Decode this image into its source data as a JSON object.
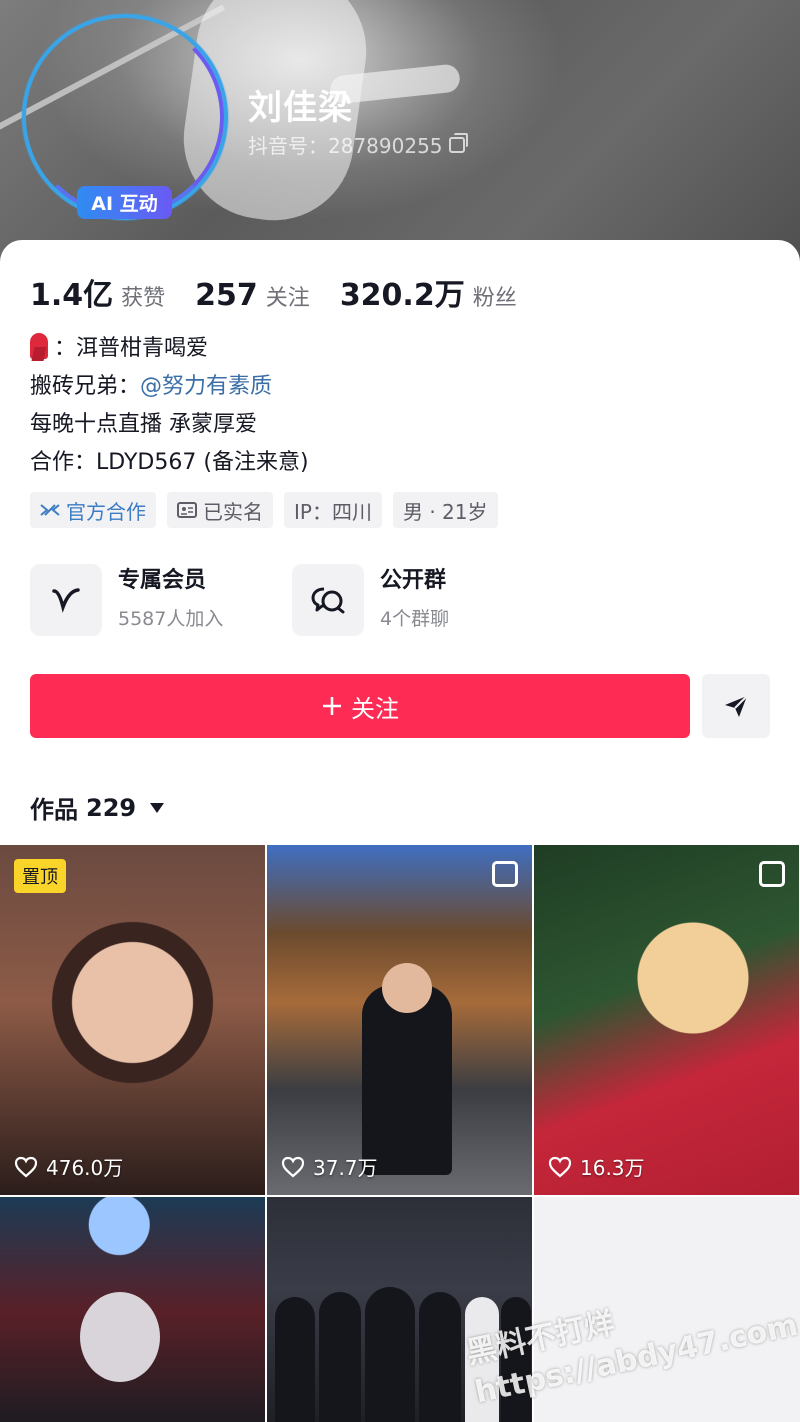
{
  "profile": {
    "ai_badge": "AI 互动",
    "name": "刘佳梁",
    "douyin_id": "抖音号：287890255"
  },
  "stats": [
    {
      "num": "1.4亿",
      "label": "获赞"
    },
    {
      "num": "257",
      "label": "关注"
    },
    {
      "num": "320.2万",
      "label": "粉丝"
    }
  ],
  "bio": {
    "line1": "：洱普柑青喝爱",
    "line2_prefix": "搬砖兄弟：",
    "line2_mention": "@努力有素质",
    "line3": "每晚十点直播 承蒙厚爱",
    "line4": "合作：LDYD567 (备注来意)"
  },
  "tags": [
    "官方合作",
    "已实名",
    "IP：四川",
    "男 · 21岁"
  ],
  "cards": [
    {
      "title": "专属会员",
      "sub": "5587人加入",
      "icon": "v-member-icon"
    },
    {
      "title": "公开群",
      "sub": "4个群聊",
      "icon": "chat-bubbles-icon"
    }
  ],
  "follow": {
    "label": "关注"
  },
  "works": {
    "label": "作品",
    "count": "229"
  },
  "videos": [
    {
      "likes": "476.0万",
      "pinned": "置顶"
    },
    {
      "likes": "37.7万"
    },
    {
      "likes": "16.3万"
    }
  ],
  "watermark": {
    "line1": "黑料不打烊",
    "line2": "https://abdy47.com"
  },
  "colors": {
    "accent": "#fe2c55",
    "mention": "#3a6ea8",
    "pin": "#fbd42a",
    "ai_gradient_start": "#2f8cf2",
    "ai_gradient_end": "#6a5af5"
  }
}
